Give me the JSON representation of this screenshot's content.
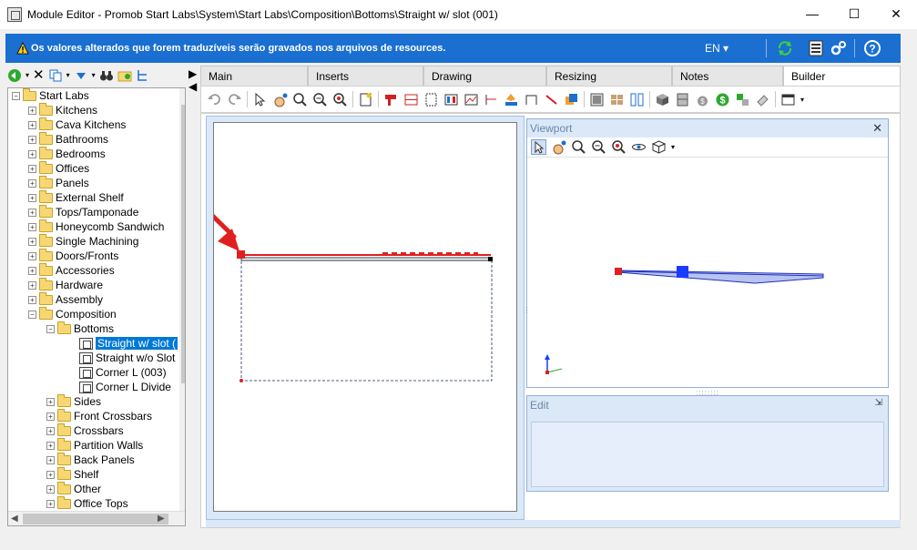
{
  "window": {
    "title": "Module Editor - Promob Start Labs\\System\\Start Labs\\Composition\\Bottoms\\Straight w/ slot (001)",
    "minimize": "—",
    "maximize": "☐",
    "close": "✕"
  },
  "infobar": {
    "message": "Os valores alterados que forem traduzíveis serão gravados nos arquivos de resources.",
    "language": "EN",
    "language_caret": "▾",
    "colors": {
      "background": "#1a6fd1"
    }
  },
  "tree": {
    "root": "Start Labs",
    "items": [
      "Kitchens",
      "Cava Kitchens",
      "Bathrooms",
      "Bedrooms",
      "Offices",
      "Panels",
      "External Shelf",
      "Tops/Tamponade",
      "Honeycomb Sandwich",
      "Single Machining",
      "Doors/Fronts",
      "Accessories",
      "Hardware",
      "Assembly"
    ],
    "composition": "Composition",
    "bottoms": "Bottoms",
    "modules": [
      "Straight w/ slot (",
      "Straight w/o Slot",
      "Corner L (003)",
      "Corner L Divide"
    ],
    "composition_items": [
      "Sides",
      "Front Crossbars",
      "Crossbars",
      "Partition Walls",
      "Back Panels",
      "Shelf",
      "Other",
      "Office Tops"
    ]
  },
  "tabs": [
    "Main",
    "Inserts",
    "Drawing",
    "Resizing",
    "Notes",
    "Builder"
  ],
  "active_tab": "Builder",
  "viewport": {
    "title": "Viewport",
    "close": "✕"
  },
  "edit": {
    "title": "Edit",
    "pin": "📌"
  },
  "colors": {
    "selection": "#0078d7",
    "accent_red": "#e02020",
    "accent_blue": "#1a3cff"
  }
}
